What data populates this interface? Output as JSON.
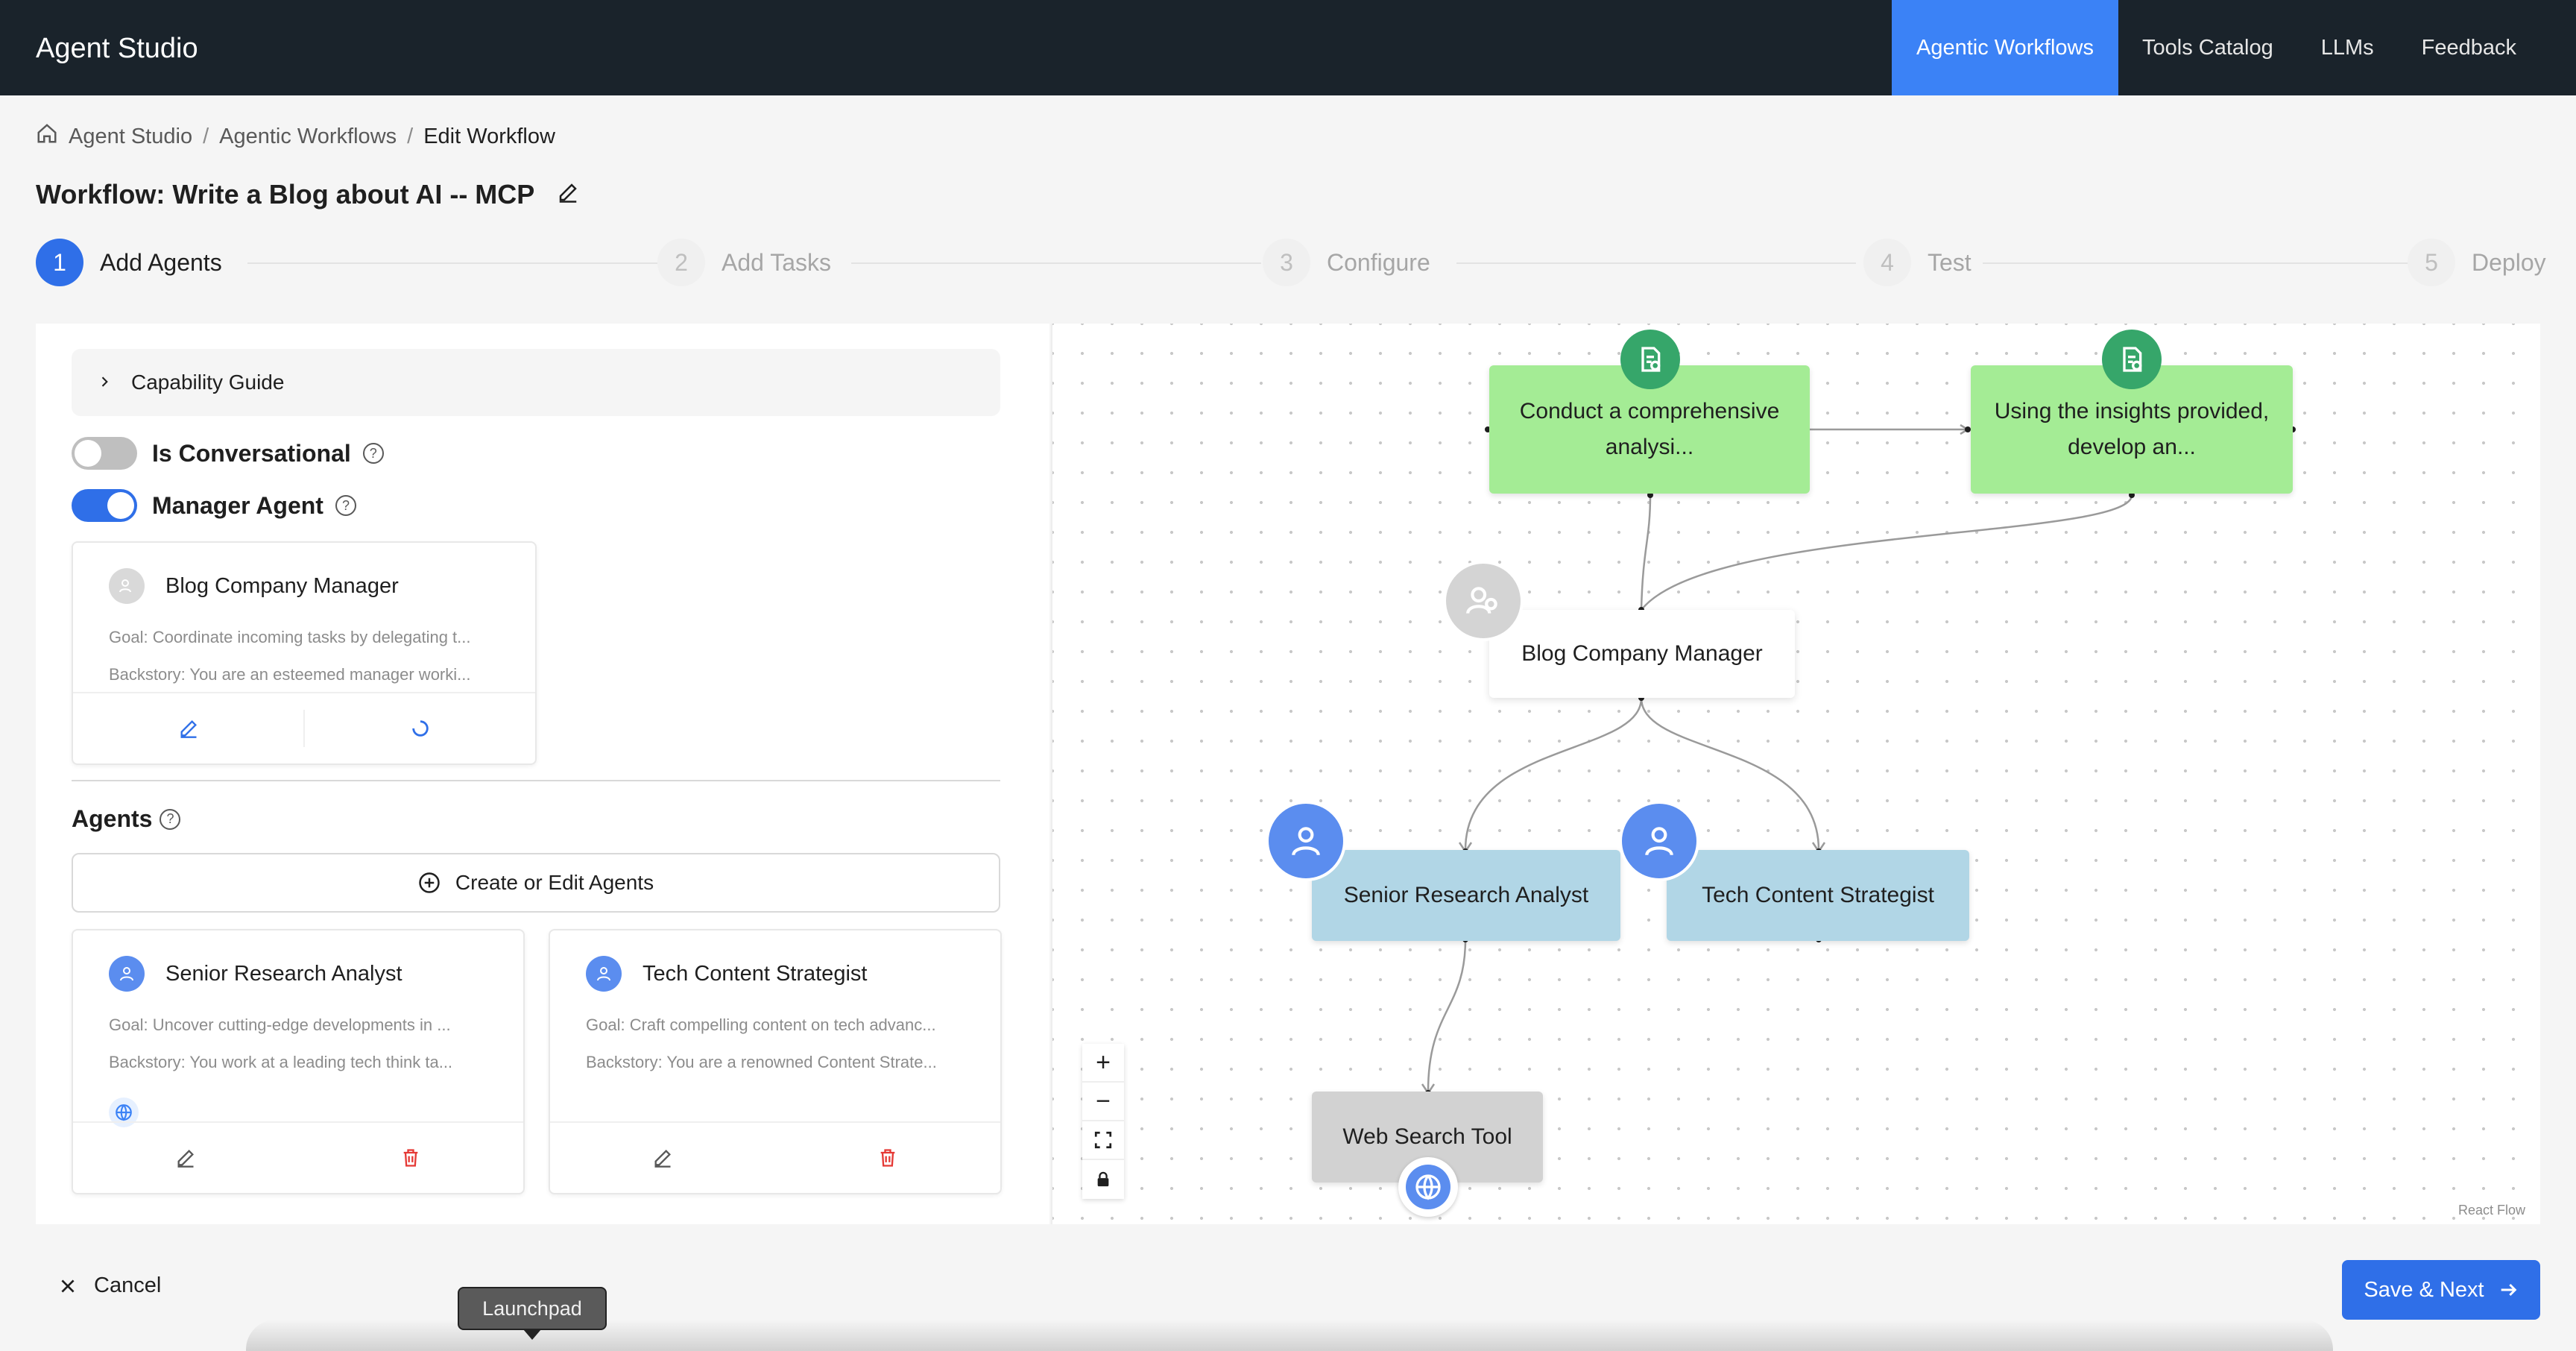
{
  "app": {
    "title": "Agent Studio"
  },
  "topnav": {
    "items": [
      {
        "label": "Agentic Workflows",
        "active": true
      },
      {
        "label": "Tools Catalog"
      },
      {
        "label": "LLMs"
      },
      {
        "label": "Feedback"
      }
    ]
  },
  "breadcrumb": {
    "items": [
      "Agent Studio",
      "Agentic Workflows",
      "Edit Workflow"
    ],
    "separator": "/"
  },
  "page": {
    "title": "Workflow: Write a Blog about AI -- MCP"
  },
  "steps": [
    {
      "num": "1",
      "label": "Add Agents",
      "active": true
    },
    {
      "num": "2",
      "label": "Add Tasks"
    },
    {
      "num": "3",
      "label": "Configure"
    },
    {
      "num": "4",
      "label": "Test"
    },
    {
      "num": "5",
      "label": "Deploy"
    }
  ],
  "left": {
    "capability_guide": "Capability Guide",
    "is_conversational": {
      "label": "Is Conversational",
      "on": false
    },
    "manager_agent": {
      "label": "Manager Agent",
      "on": true
    },
    "manager_card": {
      "name": "Blog Company Manager",
      "goal": "Goal: Coordinate incoming tasks by delegating t...",
      "backstory": "Backstory: You are an esteemed manager worki..."
    },
    "agents_heading": "Agents",
    "create_button": "Create or Edit Agents",
    "agents": [
      {
        "name": "Senior Research Analyst",
        "goal": "Goal: Uncover cutting-edge developments in ...",
        "backstory": "Backstory: You work at a leading tech think ta..."
      },
      {
        "name": "Tech Content Strategist",
        "goal": "Goal: Craft compelling content on tech advanc...",
        "backstory": "Backstory: You are a renowned Content Strate..."
      }
    ]
  },
  "canvas": {
    "tasks": [
      "Conduct a comprehensive analysi...",
      "Using the insights provided, develop an..."
    ],
    "manager": "Blog Company Manager",
    "agents": [
      "Senior Research Analyst",
      "Tech Content Strategist"
    ],
    "tool": "Web Search Tool",
    "attribution": "React Flow",
    "controls": [
      "+",
      "−",
      "fit",
      "lock"
    ]
  },
  "footer": {
    "cancel": "Cancel",
    "save": "Save & Next",
    "tooltip": "Launchpad"
  },
  "colors": {
    "topbar": "#1a232b",
    "accent": "#2f6fe8",
    "task_node": "#a4ec95",
    "agent_node": "#b1d6e6",
    "tool_node": "#d2d2d2",
    "badge_green": "#36a66a",
    "badge_blue": "#5b8def"
  }
}
